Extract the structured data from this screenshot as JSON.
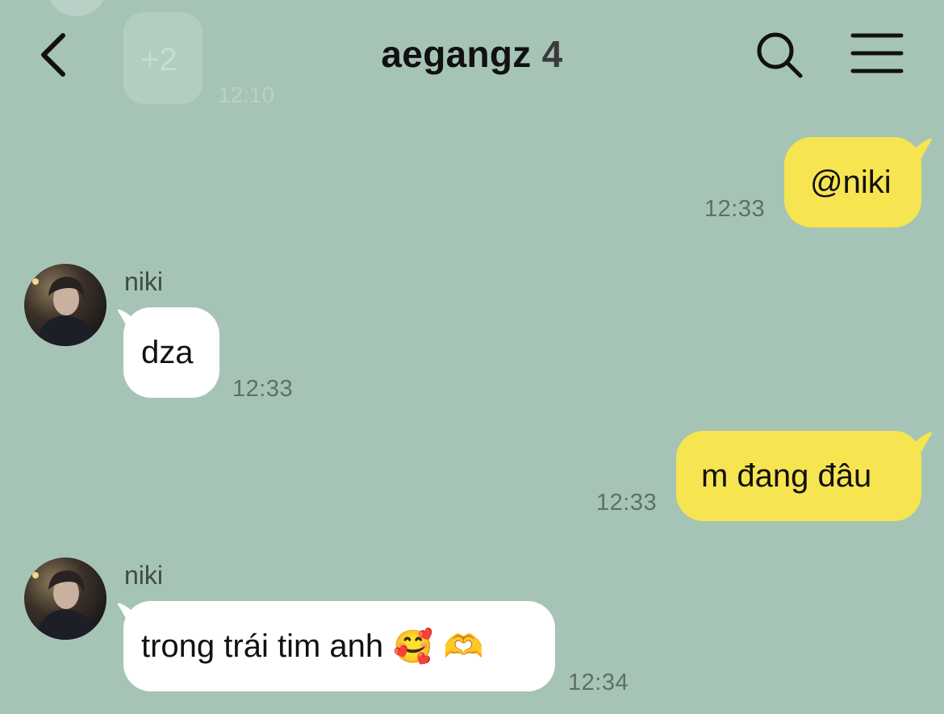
{
  "header": {
    "title": "aegangz",
    "member_count": "4"
  },
  "ghost": {
    "badge": "+2",
    "time": "12:10"
  },
  "messages": [
    {
      "from": "me",
      "text": "@niki",
      "time": "12:33"
    },
    {
      "from": "niki",
      "sender": "niki",
      "text": "dza",
      "time": "12:33"
    },
    {
      "from": "me",
      "text": "m đang đâu",
      "time": "12:33"
    },
    {
      "from": "niki",
      "sender": "niki",
      "text": "trong trái tim anh",
      "emoji": "🥰 🫶",
      "time": "12:34"
    }
  ],
  "colors": {
    "background": "#a6c4b6",
    "my_bubble": "#f7e451",
    "their_bubble": "#ffffff"
  },
  "icons": {
    "back": "chevron-left-icon",
    "search": "search-icon",
    "menu": "hamburger-menu-icon"
  }
}
